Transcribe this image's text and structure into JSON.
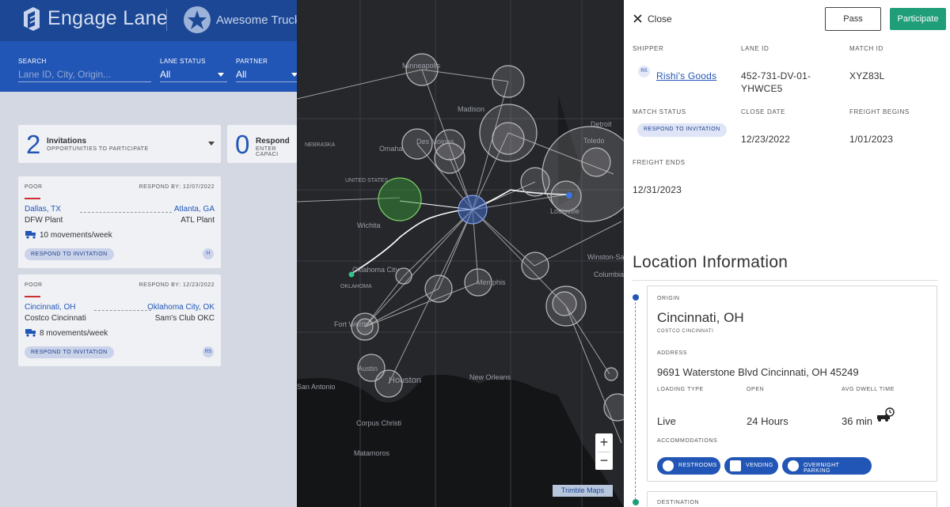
{
  "header": {
    "brand": "Engage Lane",
    "partner": "Awesome Trucking"
  },
  "filters": {
    "search_label": "SEARCH",
    "search_placeholder": "Lane ID, City, Origin...",
    "lane_status_label": "LANE STATUS",
    "lane_status_value": "All",
    "partner_label": "PARTNER",
    "partner_value": "All"
  },
  "stats": [
    {
      "count": "2",
      "title": "Invitations",
      "subtitle": "OPPORTUNITIES TO PARTICIPATE"
    },
    {
      "count": "0",
      "title": "Respond",
      "subtitle": "ENTER CAPACI"
    }
  ],
  "cards": [
    {
      "rating": "POOR",
      "respond_by": "RESPOND BY: 12/07/2022",
      "origin_city": "Dallas, TX",
      "origin_site": "DFW Plant",
      "dest_city": "Atlanta, GA",
      "dest_site": "ATL Plant",
      "movements": "10 movements/week",
      "action": "RESPOND TO INVITATION",
      "badge": "H"
    },
    {
      "rating": "POOR",
      "respond_by": "RESPOND BY: 12/23/2022",
      "origin_city": "Cincinnati, OH",
      "origin_site": "Costco Cincinnati",
      "dest_city": "Oklahoma City, OK",
      "dest_site": "Sam's Club OKC",
      "movements": "8 movements/week",
      "action": "RESPOND TO INVITATION",
      "badge": "RS"
    }
  ],
  "map": {
    "labels": [
      {
        "text": "Minneapolis"
      },
      {
        "text": "Madison"
      },
      {
        "text": "Detroit"
      },
      {
        "text": "Omaha"
      },
      {
        "text": "Des Moines"
      },
      {
        "text": "NEBRASKA"
      },
      {
        "text": "UNITED STATES"
      },
      {
        "text": "Toledo"
      },
      {
        "text": "Wichita"
      },
      {
        "text": "Louisville"
      },
      {
        "text": "Oklahoma City"
      },
      {
        "text": "OKLAHOMA"
      },
      {
        "text": "Memphis"
      },
      {
        "text": "Winston-Salem"
      },
      {
        "text": "Fort Worth"
      },
      {
        "text": "Austin"
      },
      {
        "text": "Houston"
      },
      {
        "text": "San Antonio"
      },
      {
        "text": "New Orleans"
      },
      {
        "text": "Corpus Christi"
      },
      {
        "text": "Matamoros"
      },
      {
        "text": "Columbia"
      }
    ],
    "zoom_in": "+",
    "zoom_out": "−",
    "attribution": "Trimble Maps"
  },
  "panel": {
    "close_label": "Close",
    "pass_label": "Pass",
    "participate_label": "Participate",
    "shipper_label": "SHIPPER",
    "shipper_initials": "RS",
    "shipper_name": "Rishi's Goods",
    "lane_id_label": "LANE ID",
    "lane_id_line1": "452-731-DV-01-",
    "lane_id_line2": "YHWCE5",
    "match_id_label": "MATCH ID",
    "match_id": "XYZ83L",
    "match_status_label": "MATCH STATUS",
    "match_status": "RESPOND TO INVITATION",
    "close_date_label": "CLOSE DATE",
    "close_date": "12/23/2022",
    "freight_begins_label": "FREIGHT BEGINS",
    "freight_begins": "1/01/2023",
    "freight_ends_label": "FREIGHT ENDS",
    "freight_ends": "12/31/2023"
  },
  "location": {
    "heading": "Location Information",
    "origin_label": "ORIGIN",
    "city": "Cincinnati, OH",
    "site": "COSTCO CINCINNATI",
    "address_label": "ADDRESS",
    "address": "9691 Waterstone Blvd Cincinnati, OH 45249",
    "loading_type_label": "LOADING TYPE",
    "loading_type": "Live",
    "open_label": "OPEN",
    "open": "24 Hours",
    "dwell_label": "AVG DWELL TIME",
    "dwell": "36 min",
    "accommodations_label": "ACCOMMODATIONS",
    "accommodations": [
      "RESTROOMS",
      "VENDING",
      "OVERNIGHT PARKING"
    ],
    "destination_label": "DESTINATION"
  },
  "colors": {
    "brand": "#2256b6",
    "header": "#1c4795",
    "participate": "#1f9e79",
    "poor": "#cc2f2f"
  }
}
